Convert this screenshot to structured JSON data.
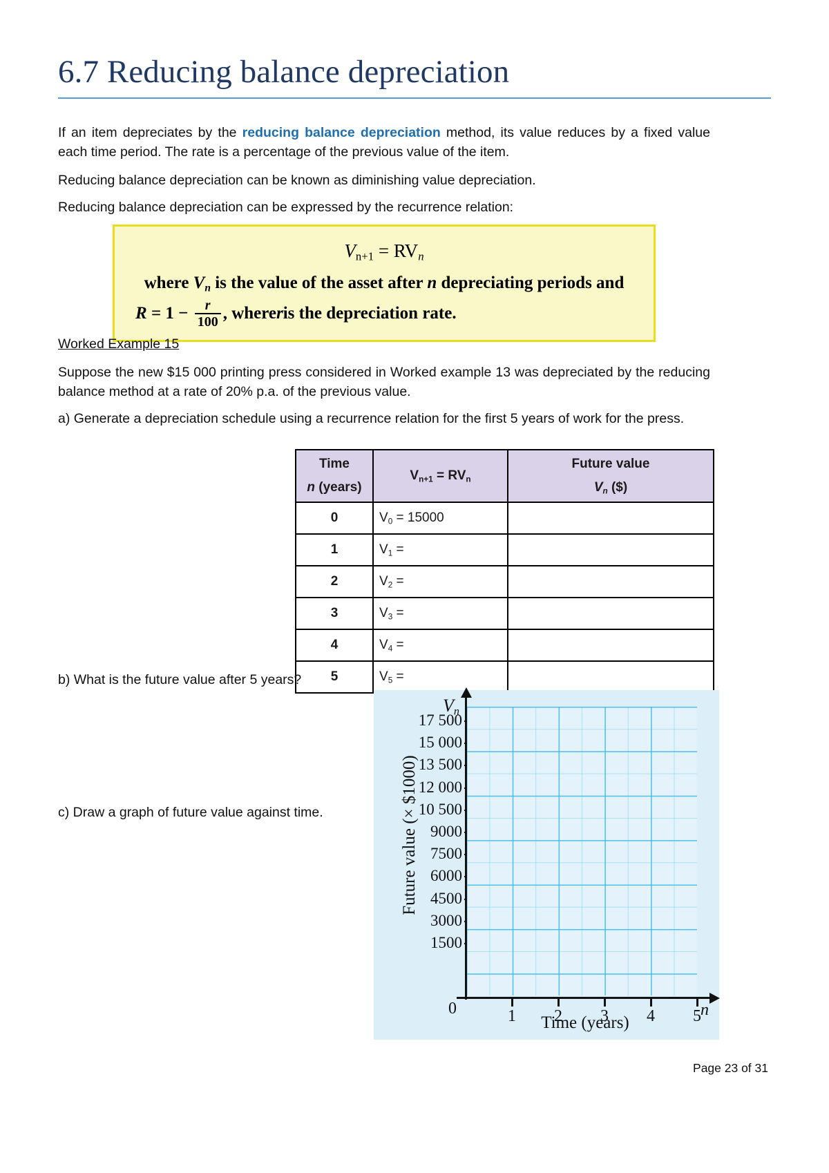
{
  "document": {
    "title": "6.7 Reducing balance depreciation",
    "footer": "Page 23 of 31"
  },
  "intro": {
    "p1_before": "If an item depreciates by the ",
    "p1_keyword": "reducing balance depreciation",
    "p1_after": " method, its value reduces by a fixed value each time period. The rate is a percentage of the previous value of the item.",
    "p2": "Reducing balance depreciation can be known as diminishing value depreciation.",
    "p3": "Reducing balance depreciation can be expressed by the recurrence relation:"
  },
  "formula_box": {
    "main_V": "V",
    "main_sub": "n+1",
    "main_eq": "= RV",
    "main_sub2": "n",
    "line2_a": "where ",
    "line2_V": "V",
    "line2_sub": "n",
    "line2_b": " is the value of the asset after ",
    "line2_n": "n",
    "line2_c": " depreciating periods and",
    "line3_R": "R",
    "line3_eq": "= 1 −",
    "line3_num": "r",
    "line3_den": "100",
    "line3_tail_a": ", where ",
    "line3_r": "r",
    "line3_tail_b": " is the depreciation rate."
  },
  "worked_example": {
    "heading": "Worked Example 15",
    "body": "Suppose the new $15 000 printing press considered in Worked example 13 was depreciated by the reducing balance method at a rate of 20% p.a. of the previous value.",
    "part_a": "a) Generate a depreciation schedule using a recurrence relation for the first 5 years of work for the press.",
    "part_b": "b) What is the future value after 5 years?",
    "part_c": "c) Draw a graph of future value against time."
  },
  "table": {
    "headers": {
      "time_line1": "Time",
      "time_line2_italic": "n",
      "time_line2_rest": " (years)",
      "recurrence_V": "V",
      "recurrence_sub": "n+1",
      "recurrence_eq": " = RV",
      "recurrence_sub2": "n",
      "future_line1": "Future value",
      "future_V": "V",
      "future_sub": "n",
      "future_unit": " ($)"
    },
    "rows": [
      {
        "n": "0",
        "recurrence_V": "V",
        "recurrence_sub": "0",
        "recurrence_rest": " = 15000",
        "future_value": ""
      },
      {
        "n": "1",
        "recurrence_V": "V",
        "recurrence_sub": "1",
        "recurrence_rest": " =",
        "future_value": ""
      },
      {
        "n": "2",
        "recurrence_V": "V",
        "recurrence_sub": "2",
        "recurrence_rest": " =",
        "future_value": ""
      },
      {
        "n": "3",
        "recurrence_V": "V",
        "recurrence_sub": "3",
        "recurrence_rest": " =",
        "future_value": ""
      },
      {
        "n": "4",
        "recurrence_V": "V",
        "recurrence_sub": "4",
        "recurrence_rest": " =",
        "future_value": ""
      },
      {
        "n": "5",
        "recurrence_V": "V",
        "recurrence_sub": "5",
        "recurrence_rest": " =",
        "future_value": ""
      }
    ]
  },
  "chart_data": {
    "type": "line",
    "title": "",
    "xlabel": "Time (years)",
    "ylabel": "Future value (× $1000)",
    "y_axis_symbol": "V",
    "y_axis_symbol_sub": "n",
    "x_axis_symbol": "n",
    "origin_label": "0",
    "x": [
      0,
      1,
      2,
      3,
      4,
      5
    ],
    "xtick_labels": [
      "1",
      "2",
      "3",
      "4",
      "5"
    ],
    "xlim": [
      0,
      5
    ],
    "ylim": [
      0,
      17500
    ],
    "ytick_labels": [
      "17 500",
      "15 000",
      "13 500",
      "12 000",
      "10 500",
      "9000",
      "7500",
      "6000",
      "4500",
      "3000",
      "1500"
    ],
    "ytick_values": [
      17500,
      15000,
      13500,
      12000,
      10500,
      9000,
      7500,
      6000,
      4500,
      3000,
      1500
    ],
    "grid": true,
    "series": [],
    "note": "Blank grid for student to plot future value against time",
    "colors": {
      "panel_background": "#DCEEF8",
      "plot_background": "#E4F3FB",
      "major_grid": "#3CB9E6",
      "minor_grid": "#78D2F0",
      "axis": "#111111"
    }
  },
  "colors": {
    "title": "#1F3864",
    "rule": "#5B9BD5",
    "keyword": "#1F6FB0",
    "formula_fill": "#FAF7C8",
    "formula_border": "#E8DE1C",
    "table_header": "#D9D2E9"
  }
}
